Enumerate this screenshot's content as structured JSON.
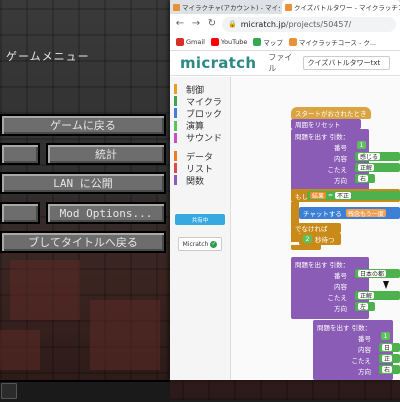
{
  "minecraft": {
    "menu_title": "ゲームメニュー",
    "buttons": {
      "back_to_game": "ゲームに戻る",
      "statistics": "統計",
      "open_to_lan": "LAN に公開",
      "mod_options": "Mod Options...",
      "save_and_quit": "ブしてタイトルへ戻る"
    }
  },
  "browser": {
    "tabs": [
      {
        "label": "マイラクチャ(アカウント) - マイクラ"
      },
      {
        "label": "クイズバトルタワー - マイクラッチコ..."
      }
    ],
    "url": {
      "host": "micratch.jp",
      "path": "/projects/50457/"
    },
    "bookmarks": [
      {
        "label": "Gmail",
        "color": "#d93025"
      },
      {
        "label": "YouTube",
        "color": "#ff0000"
      },
      {
        "label": "マップ",
        "color": "#34a853"
      },
      {
        "label": "マイクラッチコース - ク...",
        "color": "#e8913a"
      }
    ]
  },
  "app": {
    "logo": "micratch",
    "file_menu": "ファイル",
    "project_name": "クイズバトルタワーtxt",
    "categories": [
      {
        "label": "制御",
        "color": "#e6a020"
      },
      {
        "label": "マイクラ",
        "color": "#3fa34d"
      },
      {
        "label": "ブロック",
        "color": "#4a7bd6"
      },
      {
        "label": "演算",
        "color": "#5cc15c"
      },
      {
        "label": "サウンド",
        "color": "#c450c4"
      },
      {
        "label": "データ",
        "color": "#ef7b1f"
      },
      {
        "label": "リスト",
        "color": "#d84b4b"
      },
      {
        "label": "関数",
        "color": "#8b5cb5"
      }
    ],
    "account_label": "Micratch",
    "share_label": "共有中"
  },
  "blocks": {
    "start": "スタートがおされたとき",
    "reset": "周囲をリセット",
    "ask1": "問題を出す 引数：",
    "p_number": "番号",
    "p_content": "内容",
    "p_answer": "こたえ",
    "p_direction": "方向",
    "a1_number": "1",
    "a1_content": "感じる",
    "a1_answer": "正解",
    "a1_direction": "右",
    "if": "もし",
    "cond_result": "結果",
    "cond_value": "不正",
    "chat": "チャットする",
    "chat_text": "残念もう一度",
    "else": "でなければ",
    "wait_num": "2",
    "wait_label": "秒待つ",
    "ask2": "問題を出す 引数：",
    "a2_number": "1",
    "a2_content": "日本の都",
    "a2_answer": "正解",
    "a2_direction": "左",
    "ask3": "問題を出す 引数：",
    "a3_number": "1",
    "a3_content": "日",
    "a3_answer": "正",
    "a3_direction": "右"
  }
}
